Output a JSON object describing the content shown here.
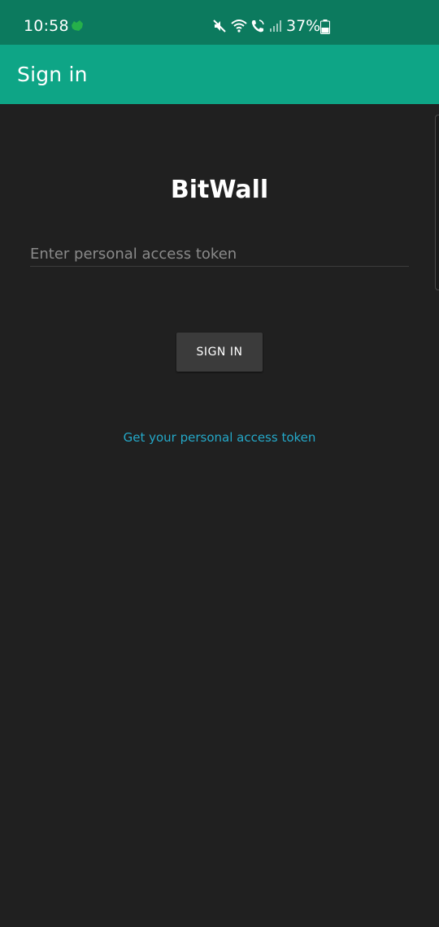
{
  "status_bar": {
    "time": "10:58",
    "battery": "37%",
    "icons": [
      "app-notification-icon",
      "mute-icon",
      "wifi-icon",
      "wifi-calling-icon",
      "cellular-signal-icon",
      "battery-icon"
    ]
  },
  "app_bar": {
    "title": "Sign in"
  },
  "main": {
    "brand": "BitWall",
    "token_placeholder": "Enter personal access token",
    "sign_in_label": "SIGN IN",
    "get_token_link": "Get your personal access token"
  },
  "colors": {
    "status_bar": "#0c7a5e",
    "app_bar": "#0ea586",
    "background": "#202020",
    "button": "#3b3b3b",
    "link": "#24a8c8"
  }
}
